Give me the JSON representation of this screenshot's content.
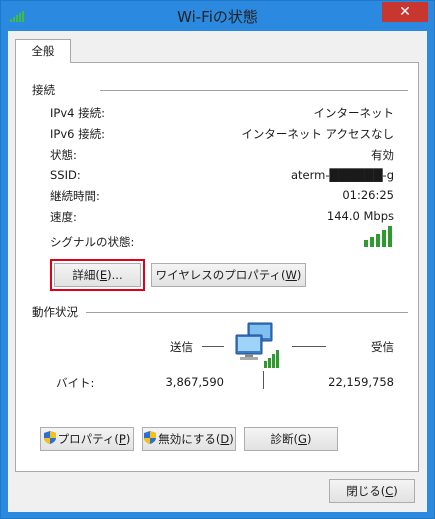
{
  "window": {
    "title": "Wi-Fiの状態",
    "close_glyph": "✕"
  },
  "tabs": [
    {
      "label": "全般"
    }
  ],
  "connection": {
    "heading": "接続",
    "rows": [
      {
        "label": "IPv4 接続:",
        "value": "インターネット"
      },
      {
        "label": "IPv6 接続:",
        "value": "インターネット アクセスなし"
      },
      {
        "label": "状態:",
        "value": "有効"
      },
      {
        "label": "SSID:",
        "value": "aterm-██████-g"
      },
      {
        "label": "継続時間:",
        "value": "01:26:25"
      },
      {
        "label": "速度:",
        "value": "144.0 Mbps"
      }
    ],
    "signal_label": "シグナルの状態:",
    "signal_bars": 5,
    "details_button": {
      "text": "詳細(",
      "key": "E",
      "suffix": ")..."
    },
    "wireless_button": {
      "text": "ワイヤレスのプロパティ(",
      "key": "W",
      "suffix": ")"
    }
  },
  "activity": {
    "heading": "動作状況",
    "sent_label": "送信",
    "received_label": "受信",
    "bytes_label": "バイト:",
    "sent_bytes": "3,867,590",
    "received_bytes": "22,159,758"
  },
  "bottom_buttons": {
    "properties": {
      "text": "プロパティ(",
      "key": "P",
      "suffix": ")"
    },
    "disable": {
      "text": "無効にする(",
      "key": "D",
      "suffix": ")"
    },
    "diagnose": {
      "text": "診断(",
      "key": "G",
      "suffix": ")"
    }
  },
  "close_button": {
    "text": "閉じる(",
    "key": "C",
    "suffix": ")"
  },
  "colors": {
    "titlebar": "#2b8ae0",
    "close": "#c7362f",
    "signal": "#2e9b2e",
    "highlight": "#e0001a"
  },
  "icons": {
    "title": "wifi-signal-icon",
    "network": "network-computers-icon",
    "shield": "uac-shield-icon"
  }
}
